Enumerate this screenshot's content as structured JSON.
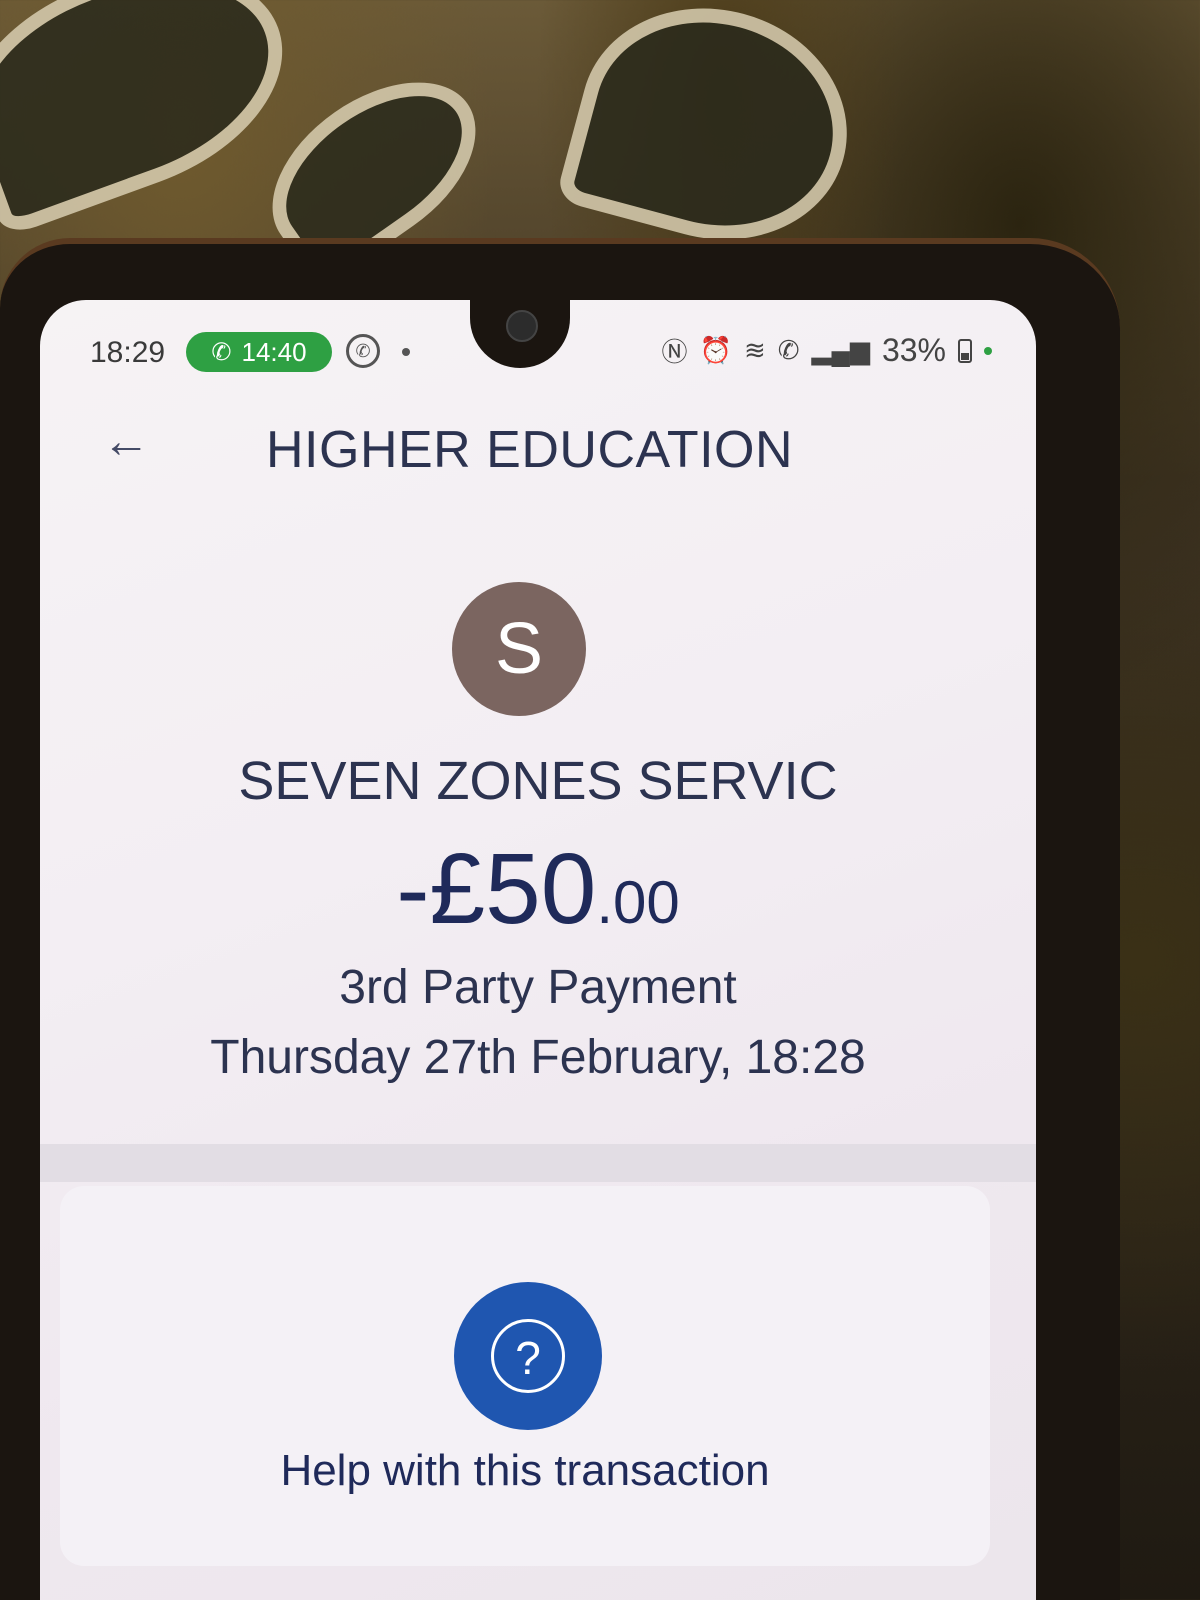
{
  "status_bar": {
    "time": "18:29",
    "call_duration": "14:40",
    "battery_percent": "33%",
    "icons": [
      "phone-icon",
      "whatsapp-icon",
      "nfc-icon",
      "alarm-icon",
      "wifi-icon",
      "wifi-calling-icon",
      "signal-icon",
      "battery-icon"
    ]
  },
  "header": {
    "back_icon": "arrow-left-icon",
    "title": "HIGHER EDUCATION"
  },
  "transaction": {
    "avatar_letter": "S",
    "merchant": "SEVEN ZONES SERVIC",
    "amount_main": "-£50",
    "amount_cents": ".00",
    "type": "3rd Party Payment",
    "datetime": "Thursday 27th February, 18:28"
  },
  "help": {
    "icon": "question-icon",
    "label": "Help with this transaction"
  },
  "colors": {
    "call_pill": "#2ea043",
    "avatar": "#7b6560",
    "help_button": "#1f56b0",
    "text": "#2c3350"
  }
}
